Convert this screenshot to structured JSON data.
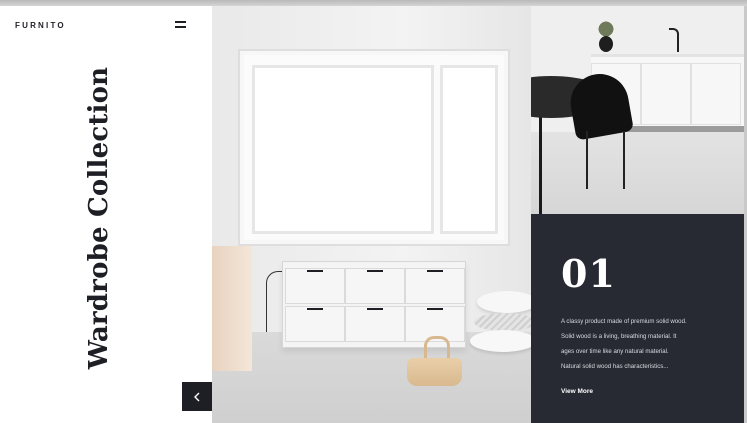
{
  "brand": {
    "logo": "FURNITO"
  },
  "header": {
    "menu_icon": "hamburger-menu-icon"
  },
  "collection": {
    "title": "Wardrobe Collection"
  },
  "slider": {
    "prev_icon": "chevron-left-icon",
    "next_icon": "chevron-right-icon",
    "prev_glyph": "<",
    "next_glyph": ">"
  },
  "feature": {
    "number": "01",
    "description_lines": [
      "A classy product made of premium solid wood.",
      "Solid wood is a living, breathing material. It",
      "ages over time like any natural material.",
      "Natural solid wood has characteristics..."
    ],
    "link_label": "View More"
  },
  "colors": {
    "dark": "#272a33",
    "text": "#1d1f24",
    "background": "#ffffff"
  }
}
